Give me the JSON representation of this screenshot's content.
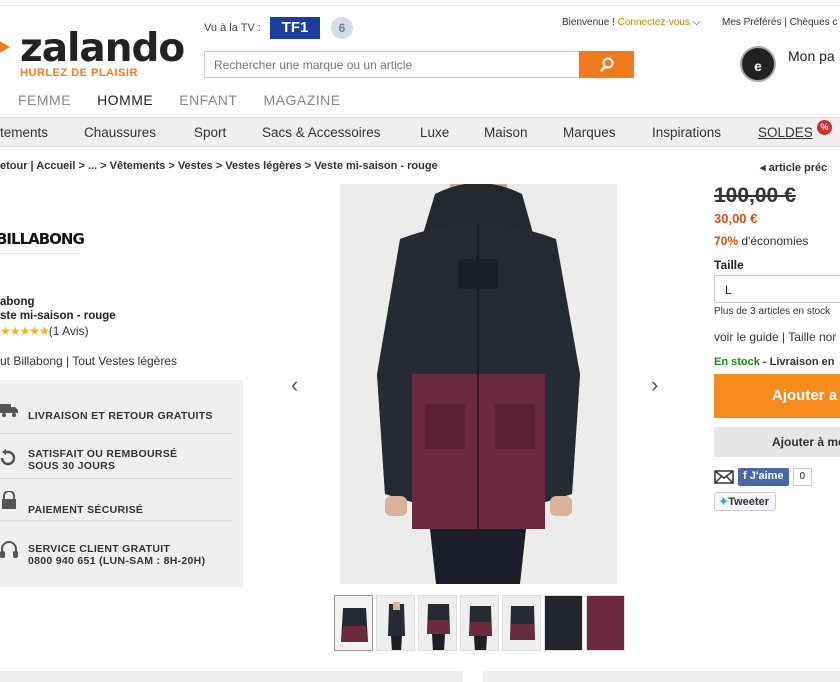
{
  "header": {
    "logo_text": "zalando",
    "logo_tagline": "HURLEZ DE PLAISIR",
    "tv_label": "Vu à la TV :",
    "tv_channel_1": "TF1",
    "tv_channel_2": "6",
    "search_placeholder": "Rechercher une marque ou un article",
    "welcome": "Bienvenue !",
    "connect": "Connectez-vous",
    "favorites": "Mes Préférés | Chèques c",
    "cart_label": "Mon pa",
    "badge_icon": "trusted-shops-badge",
    "accent_color": "#f47a20"
  },
  "gender_tabs": [
    {
      "label": "FEMME",
      "active": false
    },
    {
      "label": "HOMME",
      "active": true
    },
    {
      "label": "ENFANT",
      "active": false
    },
    {
      "label": "MAGAZINE",
      "active": false
    }
  ],
  "categories": [
    "tements",
    "Chaussures",
    "Sport",
    "Sacs & Accessoires",
    "Luxe",
    "Maison",
    "Marques",
    "Inspirations",
    "SOLDES"
  ],
  "soldes_badge": "%",
  "breadcrumb": "etour | Accueil > ... > Vêtements > Vestes > Vestes légères > Veste mi-saison - rouge",
  "prev_article": "article préc",
  "product": {
    "brand_logo": "BILLABONG",
    "brand_name": "abong",
    "name": "ste mi-saison - rouge",
    "stars": "★★★★★",
    "reviews": "(1 Avis)",
    "links": "ut Billabong | Tout Vestes légères"
  },
  "services": [
    {
      "icon": "truck-icon",
      "text": "LIVRAISON ET RETOUR GRATUITS"
    },
    {
      "icon": "return-icon",
      "text": "SATISFAIT OU REMBOURSÉ\nSOUS 30 JOURS"
    },
    {
      "icon": "lock-icon",
      "text": "PAIEMENT SÉCURISÉ"
    },
    {
      "icon": "headset-icon",
      "text": "SERVICE CLIENT GRATUIT\n0800 940 651 (LUN-SAM : 8H-20H)"
    }
  ],
  "pricing": {
    "old_price": "100,00 €",
    "new_price": "30,00 €",
    "discount_percent": "70%",
    "discount_text": "d'économies",
    "size_label": "Taille",
    "size_value": "L",
    "stock_note": "Plus de 3 articles en stock",
    "guide": "voir le guide | Taille nor",
    "in_stock": "En stock",
    "delivery": "- Livraison en",
    "add_button": "Ajouter a",
    "add_fav_button": "Ajouter à me",
    "like": "J'aime",
    "like_count": "0",
    "tweet": "Tweeter"
  }
}
